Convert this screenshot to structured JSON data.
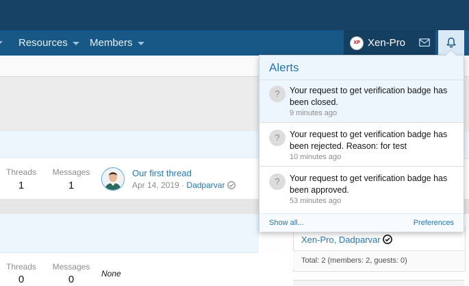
{
  "nav": {
    "prev_caret_visible": true,
    "items": [
      {
        "label": "Resources"
      },
      {
        "label": "Members"
      }
    ],
    "user": {
      "name": "Xen-Pro",
      "avatar_text": "XP"
    },
    "icons": [
      "envelope-icon",
      "bell-icon"
    ]
  },
  "forum": {
    "node1": {
      "threads_label": "Threads",
      "threads_value": "1",
      "messages_label": "Messages",
      "messages_value": "1",
      "latest_title": "Our first thread",
      "latest_date": "Apr 14, 2019",
      "latest_separator": "·",
      "latest_user": "Dadparvar"
    },
    "node2": {
      "threads_label": "Threads",
      "threads_value": "0",
      "messages_label": "Messages",
      "messages_value": "0",
      "latest": "None"
    }
  },
  "sidebar": {
    "online_names": "Xen-Pro, Dadparvar",
    "total": "Total: 2 (members: 2, guests: 0)"
  },
  "alerts": {
    "title": "Alerts",
    "items": [
      {
        "avatar": "?",
        "text": "Your request to get verification badge has been closed.",
        "time": "9 minutes ago",
        "unread": true
      },
      {
        "avatar": "?",
        "text": "Your request to get verification badge has been rejected. Reason: for test",
        "time": "10 minutes ago",
        "unread": false
      },
      {
        "avatar": "?",
        "text": "Your request to get verification badge has been approved.",
        "time": "53 minutes ago",
        "unread": false
      }
    ],
    "show_all": "Show all...",
    "preferences": "Preferences"
  },
  "colors": {
    "nav_bg": "#185886",
    "link": "#2577b1",
    "unread_bg": "#edf6fd"
  }
}
